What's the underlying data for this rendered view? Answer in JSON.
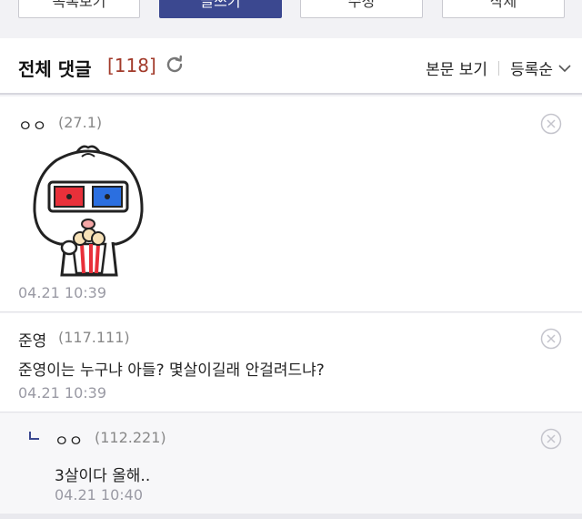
{
  "top_buttons": [
    {
      "label": "목록보기"
    },
    {
      "label": "글쓰기"
    },
    {
      "label": "수정"
    },
    {
      "label": "삭제"
    }
  ],
  "header": {
    "title": "전체 댓글",
    "count": "[118]",
    "view_post": "본문 보기",
    "sort": "등록순"
  },
  "comments": [
    {
      "author": "ㅇㅇ",
      "ip": "(27.1)",
      "body": "",
      "date": "04.21 10:39",
      "emoticon": "dumpling-popcorn-3d-glasses"
    },
    {
      "author": "준영",
      "ip": "(117.111)",
      "body": "준영이는 누구냐 아들? 몇살이길래 안걸려드냐?",
      "date": "04.21 10:39"
    },
    {
      "author": "ㅇㅇ",
      "ip": "(112.221)",
      "body": "3살이다 올해..",
      "date": "04.21 10:40",
      "reply": true
    }
  ],
  "colors": {
    "accent": "#3b4890",
    "count": "#a23a2a",
    "meta": "#888888"
  }
}
